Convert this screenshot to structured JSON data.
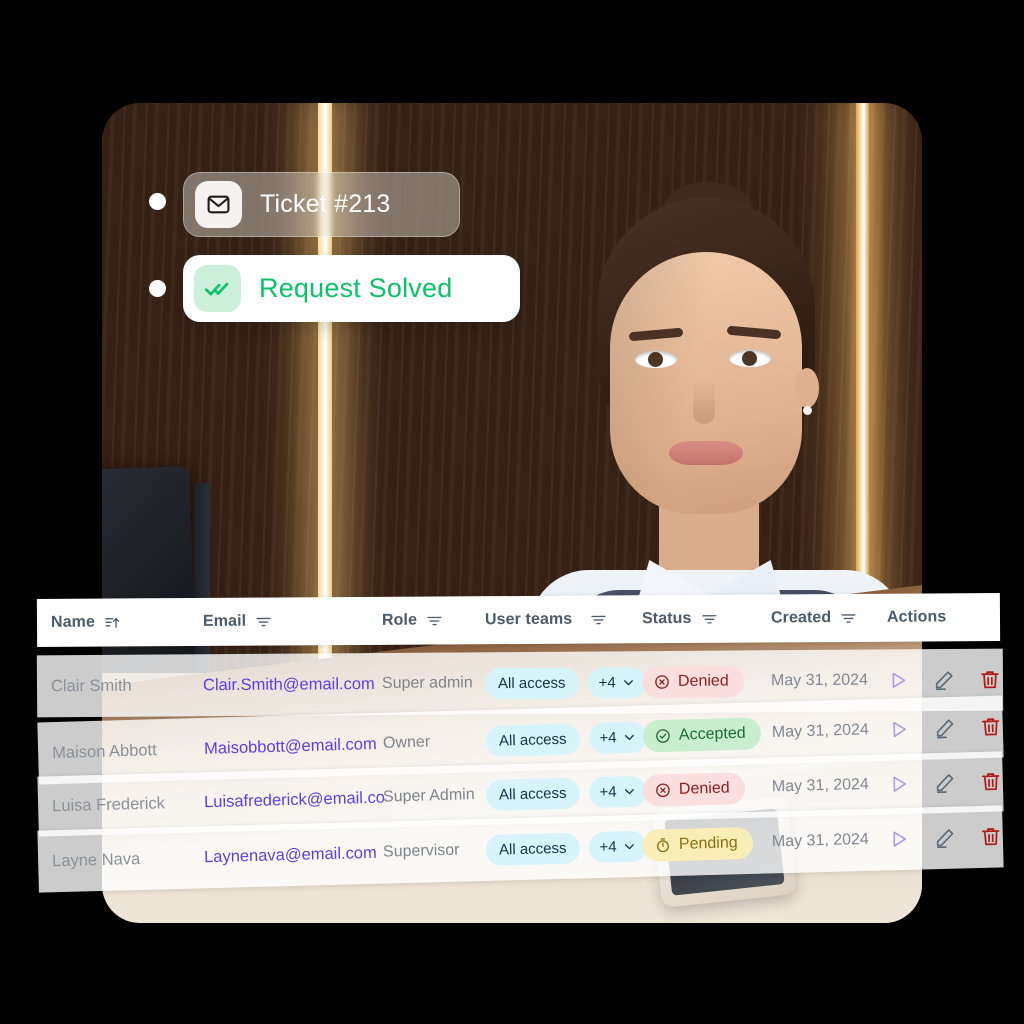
{
  "photo": {
    "alt": "hotel receptionist at wooden front desk",
    "notifications": [
      {
        "icon": "envelope-icon",
        "label": "Ticket #213",
        "style": "glass"
      },
      {
        "icon": "double-check-icon",
        "label": "Request Solved",
        "style": "solid-white"
      }
    ]
  },
  "table": {
    "columns": [
      {
        "label": "Name",
        "icon": "sort-ascending-icon"
      },
      {
        "label": "Email",
        "icon": "filter-icon"
      },
      {
        "label": "Role",
        "icon": "filter-icon"
      },
      {
        "label": "User teams",
        "icon": "filter-icon"
      },
      {
        "label": "Status",
        "icon": "filter-icon"
      },
      {
        "label": "Created",
        "icon": "filter-icon"
      },
      {
        "label": "Actions",
        "icon": ""
      }
    ],
    "rows": [
      {
        "name": "Clair Smith",
        "email": "Clair.Smith@email.com",
        "role": "Super admin",
        "team": "All access",
        "team_more": "+4",
        "status": "Denied",
        "status_icon": "x-circle-icon",
        "created": "May 31, 2024"
      },
      {
        "name": "Maison Abbott",
        "email": "Maisobbott@email.com",
        "role": "Owner",
        "team": "All access",
        "team_more": "+4",
        "status": "Accepted",
        "status_icon": "check-circle-icon",
        "created": "May 31, 2024"
      },
      {
        "name": "Luisa Frederick",
        "email": "Luisafrederick@email.cor",
        "role": "Super Admin",
        "team": "All access",
        "team_more": "+4",
        "status": "Denied",
        "status_icon": "x-circle-icon",
        "created": "May 31, 2024"
      },
      {
        "name": "Layne Nava",
        "email": "Laynenava@email.com",
        "role": "Supervisor",
        "team": "All access",
        "team_more": "+4",
        "status": "Pending",
        "status_icon": "timer-icon",
        "created": "May 31, 2024"
      }
    ],
    "actions": [
      {
        "name": "send-button",
        "icon": "play-triangle-icon"
      },
      {
        "name": "edit-button",
        "icon": "pencil-icon"
      },
      {
        "name": "delete-button",
        "icon": "trash-icon"
      }
    ]
  },
  "colors": {
    "email_link": "#5b3fe0",
    "chip_bg": "#d8f4fb",
    "denied": "#8c2020",
    "accepted": "#1e6c33",
    "pending": "#8a6f12",
    "solved_green": "#0bc268",
    "delete_red": "#b01c1c"
  }
}
